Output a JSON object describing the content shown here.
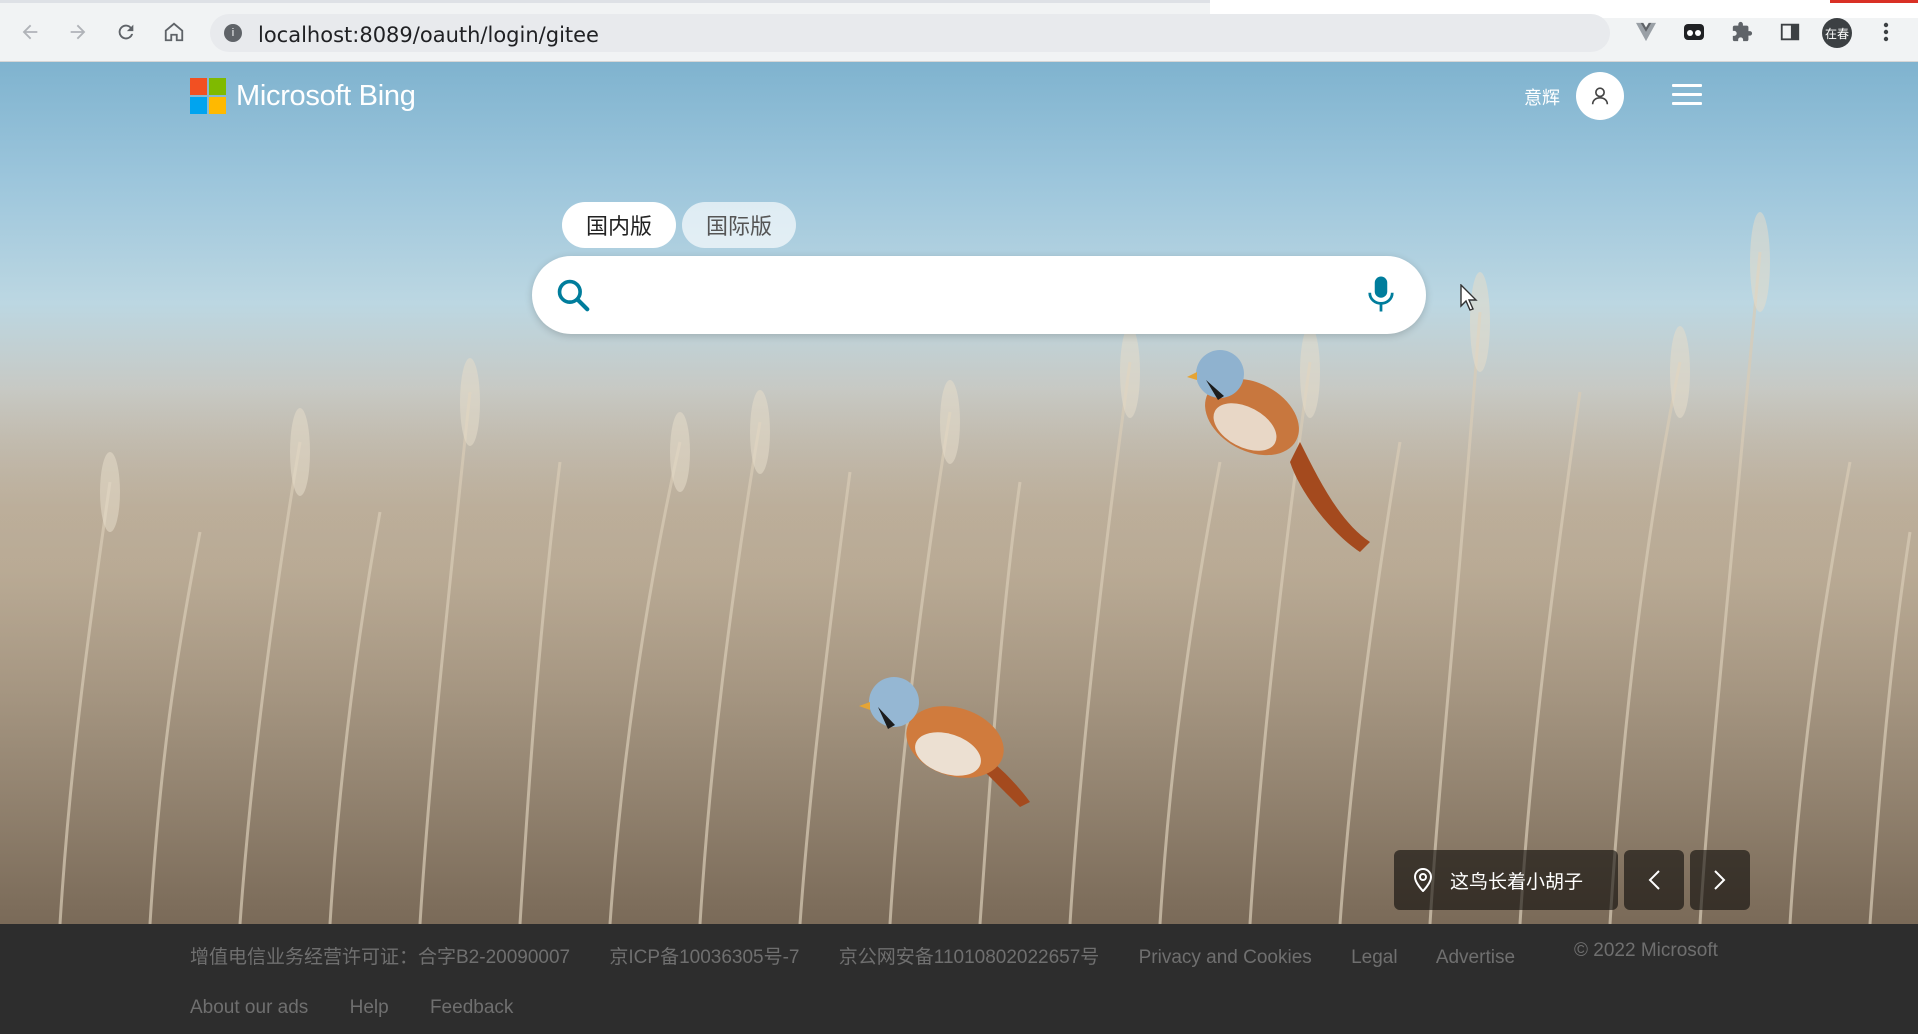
{
  "browser": {
    "url": "localhost:8089/oauth/login/gitee",
    "profile_label": "在春"
  },
  "header": {
    "brand": "Microsoft Bing",
    "user_name": "意辉"
  },
  "tabs": {
    "domestic": "国内版",
    "international": "国际版",
    "active": "国内版"
  },
  "search": {
    "value": "",
    "placeholder": ""
  },
  "image_caption": {
    "title": "这鸟长着小胡子"
  },
  "footer": {
    "links_row1": [
      "增值电信业务经营许可证：合字B2-20090007",
      "京ICP备10036305号-7",
      "京公网安备11010802022657号",
      "Privacy and Cookies",
      "Legal",
      "Advertise"
    ],
    "links_row2": [
      "About our ads",
      "Help",
      "Feedback"
    ],
    "copyright": "© 2022 Microsoft"
  },
  "colors": {
    "ms_red": "#f25022",
    "ms_green": "#7fba00",
    "ms_blue": "#00a4ef",
    "ms_yellow": "#ffb900",
    "accent": "#007d9c",
    "footer_bg": "#2d2d2d"
  }
}
